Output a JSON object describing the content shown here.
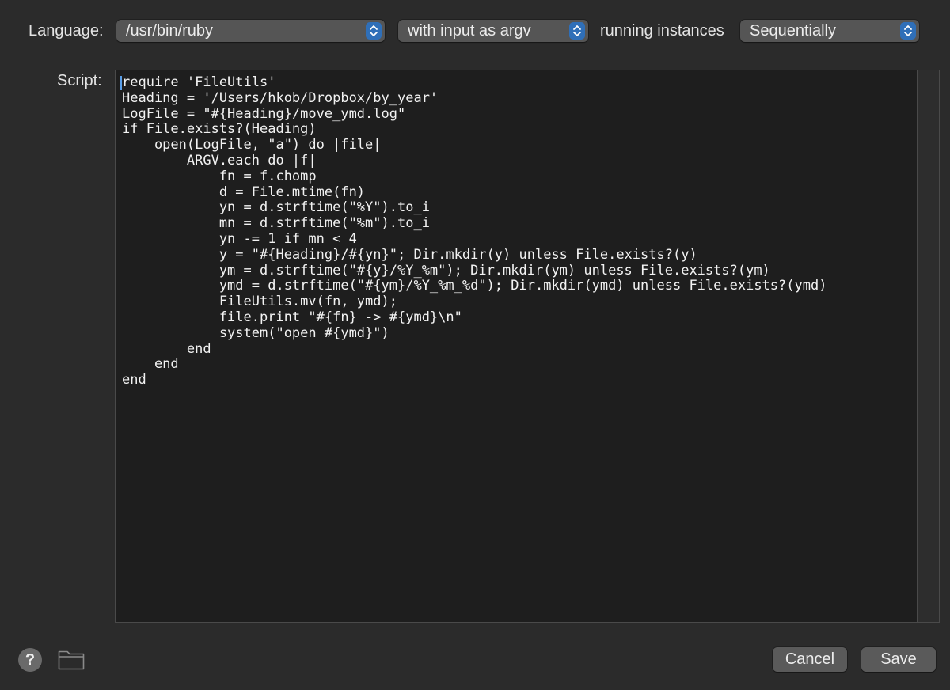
{
  "toolbar": {
    "language_label": "Language:",
    "language_value": "/usr/bin/ruby",
    "input_mode_value": "with input as argv",
    "running_label": "running instances",
    "running_value": "Sequentially"
  },
  "editor": {
    "label": "Script:",
    "code": "require 'FileUtils'\nHeading = '/Users/hkob/Dropbox/by_year'\nLogFile = \"#{Heading}/move_ymd.log\"\nif File.exists?(Heading)\n    open(LogFile, \"a\") do |file|\n        ARGV.each do |f|\n            fn = f.chomp\n            d = File.mtime(fn)\n            yn = d.strftime(\"%Y\").to_i\n            mn = d.strftime(\"%m\").to_i\n            yn -= 1 if mn < 4\n            y = \"#{Heading}/#{yn}\"; Dir.mkdir(y) unless File.exists?(y)\n            ym = d.strftime(\"#{y}/%Y_%m\"); Dir.mkdir(ym) unless File.exists?(ym)\n            ymd = d.strftime(\"#{ym}/%Y_%m_%d\"); Dir.mkdir(ymd) unless File.exists?(ymd)\n            FileUtils.mv(fn, ymd);\n            file.print \"#{fn} -> #{ymd}\\n\"\n            system(\"open #{ymd}\")\n        end\n    end\nend"
  },
  "footer": {
    "help_label": "?",
    "cancel_label": "Cancel",
    "save_label": "Save"
  },
  "icons": {
    "help": "question-mark-icon",
    "folder": "folder-icon",
    "stepper": "chevron-up-down-icon"
  },
  "colors": {
    "background": "#2b2b2b",
    "editor_background": "#1e1e1e",
    "popup_background": "#555555",
    "accent": "#2f6fb8",
    "button_background": "#5a5a5a"
  }
}
